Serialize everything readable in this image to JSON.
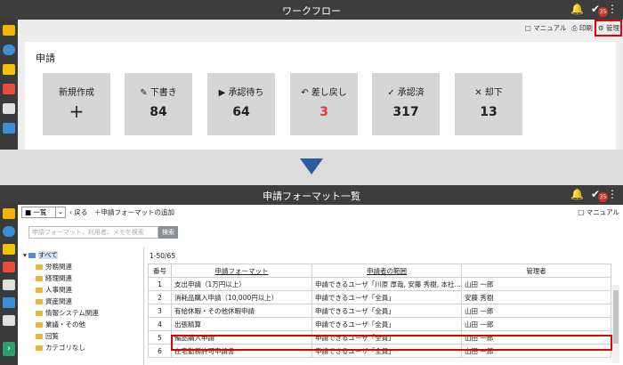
{
  "top": {
    "title": "ワークフロー",
    "badge_count": "35",
    "toolbar": {
      "manual": "マニュアル",
      "print": "印刷",
      "admin": "管理"
    },
    "section_title": "申請",
    "tiles": [
      {
        "label": "新規作成",
        "value": "+"
      },
      {
        "label": "下書き",
        "value": "84"
      },
      {
        "label": "承認待ち",
        "value": "64"
      },
      {
        "label": "差し戻し",
        "value": "3"
      },
      {
        "label": "承認済",
        "value": "317"
      },
      {
        "label": "却下",
        "value": "13"
      }
    ]
  },
  "bottom": {
    "title": "申請フォーマット一覧",
    "badge_count": "35",
    "view_select": "一覧",
    "back": "戻る",
    "add_format": "申請フォーマットの追加",
    "manual": "マニュアル",
    "search_placeholder": "申請フォーマット、利用者、メモを検索",
    "search_button": "検索",
    "tree": {
      "root": "すべて",
      "items": [
        "労務関連",
        "経理関連",
        "人事関連",
        "資産関連",
        "情報システム関連",
        "業議・その他",
        "回覧",
        "カテゴリなし"
      ]
    },
    "pagination": "1-50/65",
    "table": {
      "headers": [
        "番号",
        "申請フォーマット",
        "申請者の範囲",
        "管理者"
      ],
      "rows": [
        [
          "1",
          "支出申請（1万円以上）",
          "申請できるユーザ「川原 厚哉, 安藤 秀樹, 本社…",
          "山田 一郎"
        ],
        [
          "2",
          "消耗品購入申請（10,000円以上）",
          "申請できるユーザ「全員」",
          "安藤 秀樹"
        ],
        [
          "3",
          "有給休暇・その他休暇申請",
          "申請できるユーザ「全員」",
          "山田 一郎"
        ],
        [
          "4",
          "出張精算",
          "申請できるユーザ「全員」",
          "山田 一郎"
        ],
        [
          "5",
          "備品購入申請",
          "申請できるユーザ「全員」",
          "山田 一郎"
        ],
        [
          "6",
          "在宅勤務許可申請書",
          "申請できるユーザ「全員」",
          "山田 一郎"
        ]
      ]
    }
  },
  "colors": {
    "highlight": "#e00000",
    "arrow": "#2d5aa0",
    "returned_value": "#e53935"
  }
}
